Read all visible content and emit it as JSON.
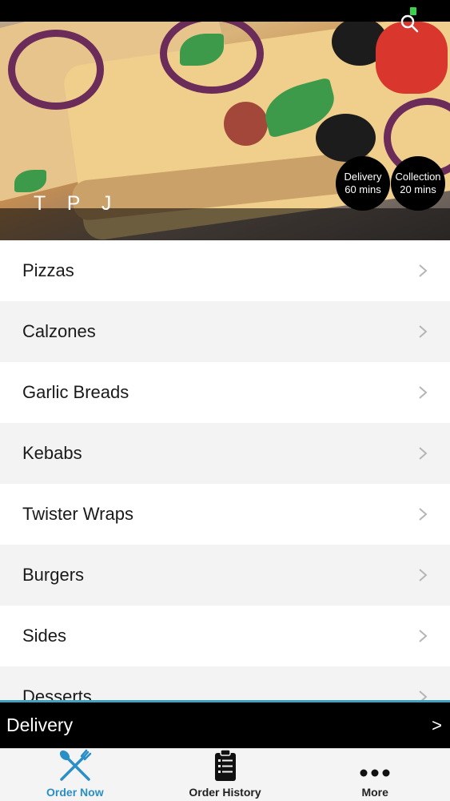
{
  "header": {
    "brand": "T P J",
    "delivery_badge": {
      "title": "Delivery",
      "time": "60 mins"
    },
    "collection_badge": {
      "title": "Collection",
      "time": "20 mins"
    }
  },
  "menu": {
    "items": [
      {
        "label": "Pizzas"
      },
      {
        "label": "Calzones"
      },
      {
        "label": "Garlic Breads"
      },
      {
        "label": "Kebabs"
      },
      {
        "label": "Twister Wraps"
      },
      {
        "label": "Burgers"
      },
      {
        "label": "Sides"
      },
      {
        "label": "Desserts"
      }
    ]
  },
  "order_mode": {
    "label": "Delivery",
    "arrow": ">"
  },
  "tabbar": {
    "tabs": [
      {
        "label": "Order Now",
        "icon": "fork-knife-icon",
        "active": true
      },
      {
        "label": "Order History",
        "icon": "clipboard-list-icon",
        "active": false
      },
      {
        "label": "More",
        "icon": "more-dots-icon",
        "active": false
      }
    ]
  },
  "colors": {
    "accent": "#2a8ec7",
    "bar": "#000000",
    "divider": "#3fa2c0"
  }
}
